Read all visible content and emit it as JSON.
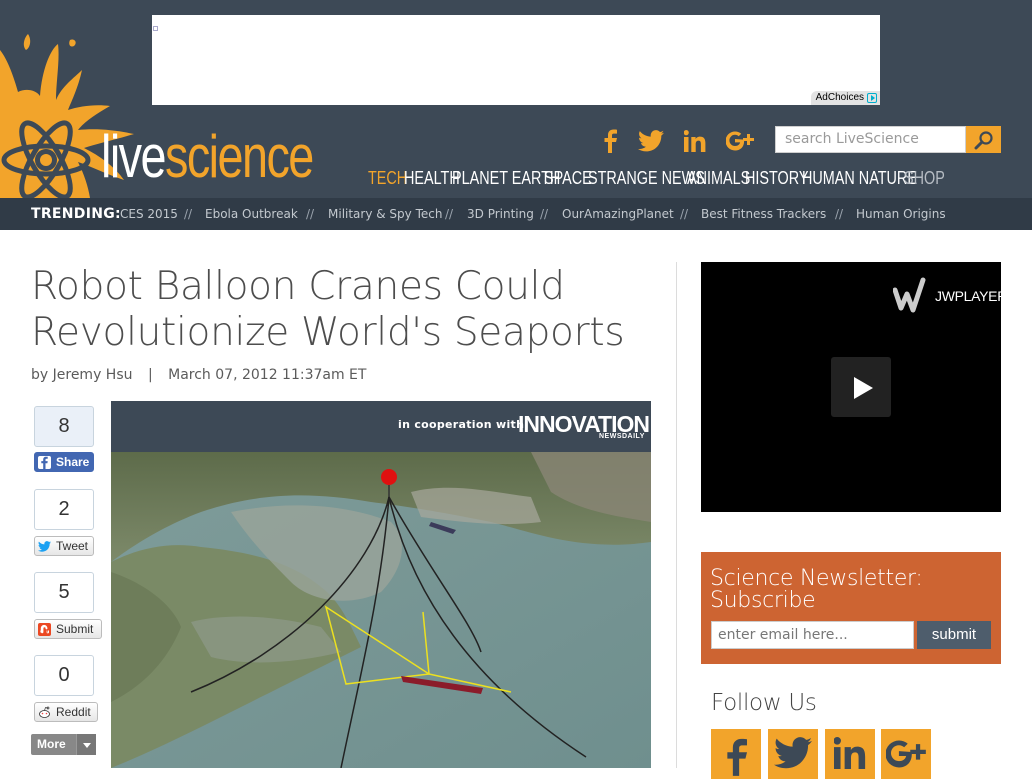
{
  "ad": {
    "adchoices_label": "AdChoices"
  },
  "logo": {
    "part1": "live",
    "part2": "science"
  },
  "header": {
    "social": [
      {
        "icon": "facebook-icon"
      },
      {
        "icon": "twitter-icon"
      },
      {
        "icon": "linkedin-icon"
      },
      {
        "icon": "googleplus-icon"
      }
    ],
    "search_placeholder": "search LiveScience"
  },
  "nav": [
    "TECH",
    "HEALTH",
    "PLANET EARTH",
    "SPACE",
    "STRANGE NEWS",
    "ANIMALS",
    "HISTORY",
    "HUMAN NATURE",
    "SHOP"
  ],
  "trending": {
    "label": "TRENDING:",
    "items": [
      "CES 2015",
      "Ebola Outbreak",
      "Military & Spy Tech",
      "3D Printing",
      "OurAmazingPlanet",
      "Best Fitness Trackers",
      "Human Origins"
    ],
    "separator": "//"
  },
  "article": {
    "title": "Robot Balloon Cranes Could Revolutionize World's Seaports",
    "by": "by",
    "author": "Jeremy Hsu",
    "pipe": "|",
    "date": "March 07, 2012 11:37am ET",
    "coop_text": "in cooperation with",
    "coop_brand": "INNOVATION",
    "coop_brand_sub": "NEWSDAILY"
  },
  "share": [
    {
      "count": "8",
      "label": "Share"
    },
    {
      "count": "2",
      "label": "Tweet"
    },
    {
      "count": "5",
      "label": "Submit"
    },
    {
      "count": "0",
      "label": "Reddit"
    }
  ],
  "more_label": "More",
  "video": {
    "player_label": "JWPLAYER"
  },
  "newsletter": {
    "title": "Science Newsletter: Subscribe",
    "placeholder": "enter email here...",
    "submit": "submit"
  },
  "follow": {
    "title": "Follow Us"
  },
  "colors": {
    "header": "#3d4956",
    "trending": "#303b47",
    "accent": "#f2a42b",
    "newsletter": "#cd6432"
  }
}
